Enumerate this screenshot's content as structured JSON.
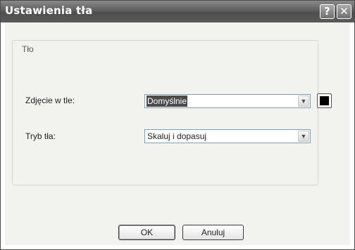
{
  "window": {
    "title": "Ustawienia tła",
    "help_label": "?",
    "close_label": "✕"
  },
  "group": {
    "title": "Tło"
  },
  "fields": {
    "background_image": {
      "label": "Zdjęcie w tle:",
      "value": "Domyślnie",
      "color_swatch": "#000000"
    },
    "background_mode": {
      "label": "Tryb tła:",
      "value": "Skaluj i dopasuj"
    }
  },
  "buttons": {
    "ok_label": "OK",
    "cancel_label": "Anuluj"
  },
  "icons": {
    "dropdown": "chevron-down-icon"
  }
}
